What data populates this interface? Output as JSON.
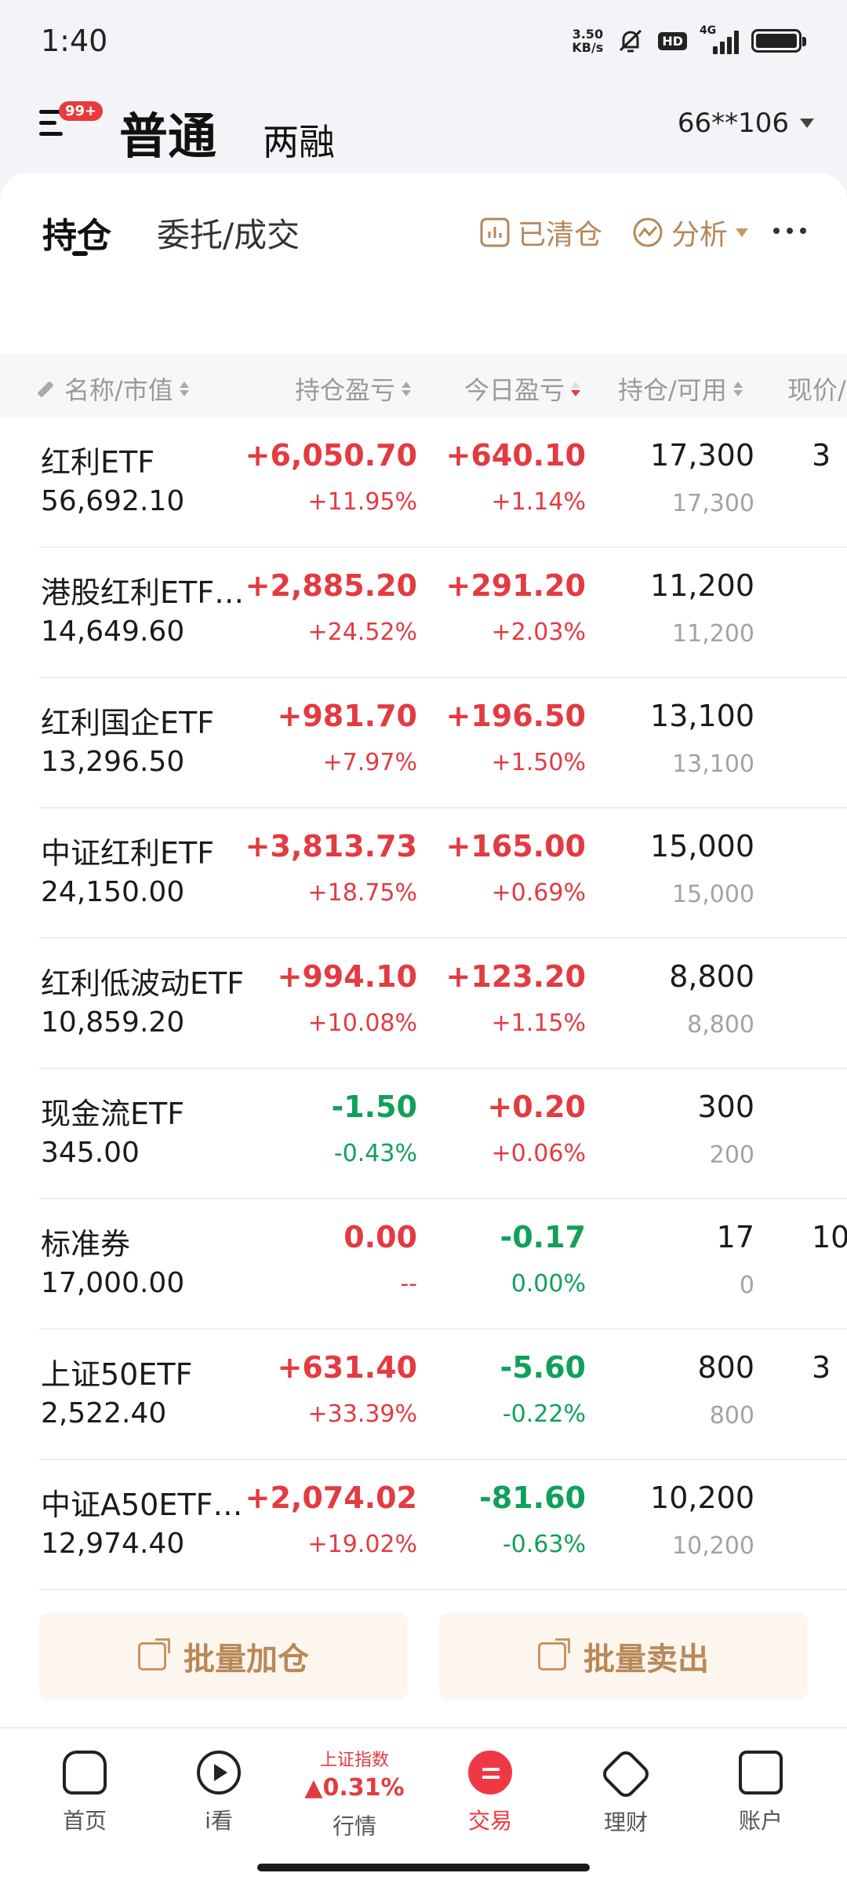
{
  "status_bar": {
    "time": "1:40",
    "net_speed_value": "3.50",
    "net_speed_unit": "KB/s",
    "hd": "HD",
    "network": "4G"
  },
  "header": {
    "notification_badge": "99+",
    "tab_normal": "普通",
    "tab_margin": "两融",
    "account": "66**106"
  },
  "subtabs": {
    "holdings": "持仓",
    "orders": "委托/成交",
    "cleared": "已清仓",
    "analysis": "分析"
  },
  "columns": {
    "name": "名称/市值",
    "position_pl": "持仓盈亏",
    "today_pl": "今日盈亏",
    "position": "持仓/可用",
    "price": "现价/"
  },
  "holdings": [
    {
      "name": "红利ETF",
      "market_value": "56,692.10",
      "pl": "+6,050.70",
      "pl_pct": "+11.95%",
      "today": "+640.10",
      "today_pct": "+1.14%",
      "position": "17,300",
      "available": "17,300",
      "price": "3"
    },
    {
      "name": "港股红利ETF…",
      "market_value": "14,649.60",
      "pl": "+2,885.20",
      "pl_pct": "+24.52%",
      "today": "+291.20",
      "today_pct": "+2.03%",
      "position": "11,200",
      "available": "11,200",
      "price": ""
    },
    {
      "name": "红利国企ETF",
      "market_value": "13,296.50",
      "pl": "+981.70",
      "pl_pct": "+7.97%",
      "today": "+196.50",
      "today_pct": "+1.50%",
      "position": "13,100",
      "available": "13,100",
      "price": ""
    },
    {
      "name": "中证红利ETF",
      "market_value": "24,150.00",
      "pl": "+3,813.73",
      "pl_pct": "+18.75%",
      "today": "+165.00",
      "today_pct": "+0.69%",
      "position": "15,000",
      "available": "15,000",
      "price": ""
    },
    {
      "name": "红利低波动ETF",
      "market_value": "10,859.20",
      "pl": "+994.10",
      "pl_pct": "+10.08%",
      "today": "+123.20",
      "today_pct": "+1.15%",
      "position": "8,800",
      "available": "8,800",
      "price": ""
    },
    {
      "name": "现金流ETF",
      "market_value": "345.00",
      "pl": "-1.50",
      "pl_pct": "-0.43%",
      "today": "+0.20",
      "today_pct": "+0.06%",
      "position": "300",
      "available": "200",
      "price": ""
    },
    {
      "name": "标准券",
      "market_value": "17,000.00",
      "pl": "0.00",
      "pl_pct": "--",
      "today": "-0.17",
      "today_pct": "0.00%",
      "position": "17",
      "available": "0",
      "price": "10"
    },
    {
      "name": "上证50ETF",
      "market_value": "2,522.40",
      "pl": "+631.40",
      "pl_pct": "+33.39%",
      "today": "-5.60",
      "today_pct": "-0.22%",
      "position": "800",
      "available": "800",
      "price": "3"
    },
    {
      "name": "中证A50ETF…",
      "market_value": "12,974.40",
      "pl": "+2,074.02",
      "pl_pct": "+19.02%",
      "today": "-81.60",
      "today_pct": "-0.63%",
      "position": "10,200",
      "available": "10,200",
      "price": ""
    }
  ],
  "batch": {
    "add": "批量加仓",
    "sell": "批量卖出"
  },
  "bottom_nav": {
    "home": "首页",
    "watch": "i看",
    "market_index_name": "上证指数",
    "market_index_value": "▲0.31%",
    "market": "行情",
    "trade": "交易",
    "wealth": "理财",
    "account": "账户"
  },
  "colors": {
    "up": "#e23b41",
    "down": "#10a05a",
    "accent": "#b98858"
  }
}
